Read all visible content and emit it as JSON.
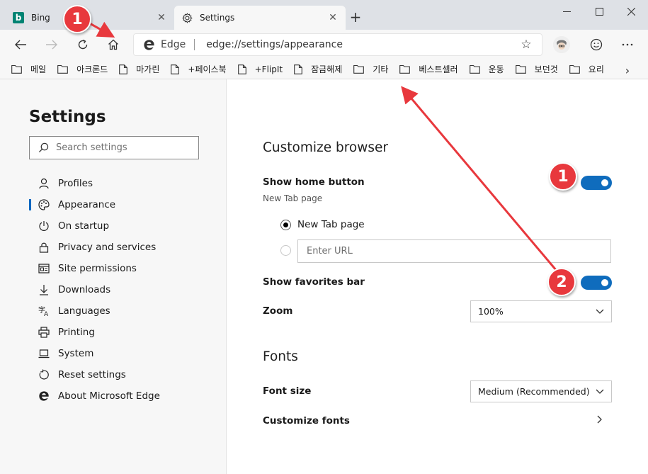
{
  "tabs": [
    {
      "title": "Bing",
      "icon": "bing-logo-icon",
      "active": false
    },
    {
      "title": "Settings",
      "icon": "gear-icon",
      "active": true
    }
  ],
  "bing_letter": "b",
  "toolbar": {
    "address_label": "Edge",
    "url": "edge://settings/appearance"
  },
  "favorites": [
    {
      "label": "메일",
      "icon": "folder-icon"
    },
    {
      "label": "아크론드",
      "icon": "folder-icon"
    },
    {
      "label": "마가린",
      "icon": "page-icon"
    },
    {
      "label": "+페이스북",
      "icon": "page-icon"
    },
    {
      "label": "+FlipIt",
      "icon": "page-icon"
    },
    {
      "label": "잠금해제",
      "icon": "page-icon"
    },
    {
      "label": "기타",
      "icon": "folder-icon"
    },
    {
      "label": "베스트셀러",
      "icon": "folder-icon"
    },
    {
      "label": "운동",
      "icon": "folder-icon"
    },
    {
      "label": "보던것",
      "icon": "folder-icon"
    },
    {
      "label": "요리",
      "icon": "folder-icon"
    }
  ],
  "sidebar": {
    "title": "Settings",
    "search_placeholder": "Search settings",
    "items": [
      {
        "label": "Profiles",
        "icon": "person-icon"
      },
      {
        "label": "Appearance",
        "icon": "palette-icon",
        "active": true
      },
      {
        "label": "On startup",
        "icon": "power-icon"
      },
      {
        "label": "Privacy and services",
        "icon": "lock-icon"
      },
      {
        "label": "Site permissions",
        "icon": "site-permissions-icon"
      },
      {
        "label": "Downloads",
        "icon": "download-icon"
      },
      {
        "label": "Languages",
        "icon": "languages-icon"
      },
      {
        "label": "Printing",
        "icon": "printer-icon"
      },
      {
        "label": "System",
        "icon": "laptop-icon"
      },
      {
        "label": "Reset settings",
        "icon": "reset-icon"
      },
      {
        "label": "About Microsoft Edge",
        "icon": "edge-logo-icon"
      }
    ]
  },
  "main": {
    "customize_heading": "Customize browser",
    "home_button_label": "Show home button",
    "home_button_sub": "New Tab page",
    "home_button_on": true,
    "radio_newtab_label": "New Tab page",
    "url_placeholder": "Enter URL",
    "favorites_bar_label": "Show favorites bar",
    "favorites_bar_on": true,
    "zoom_label": "Zoom",
    "zoom_value": "100%",
    "fonts_heading": "Fonts",
    "font_size_label": "Font size",
    "font_size_value": "Medium (Recommended)",
    "customize_fonts_label": "Customize fonts"
  },
  "annotations": [
    {
      "label": "1"
    },
    {
      "label": "1"
    },
    {
      "label": "2"
    }
  ],
  "colors": {
    "accent": "#0f6cbd",
    "annotation": "#e8383d",
    "tabstrip": "#dee1e6",
    "toolbar": "#f7f7f7"
  }
}
